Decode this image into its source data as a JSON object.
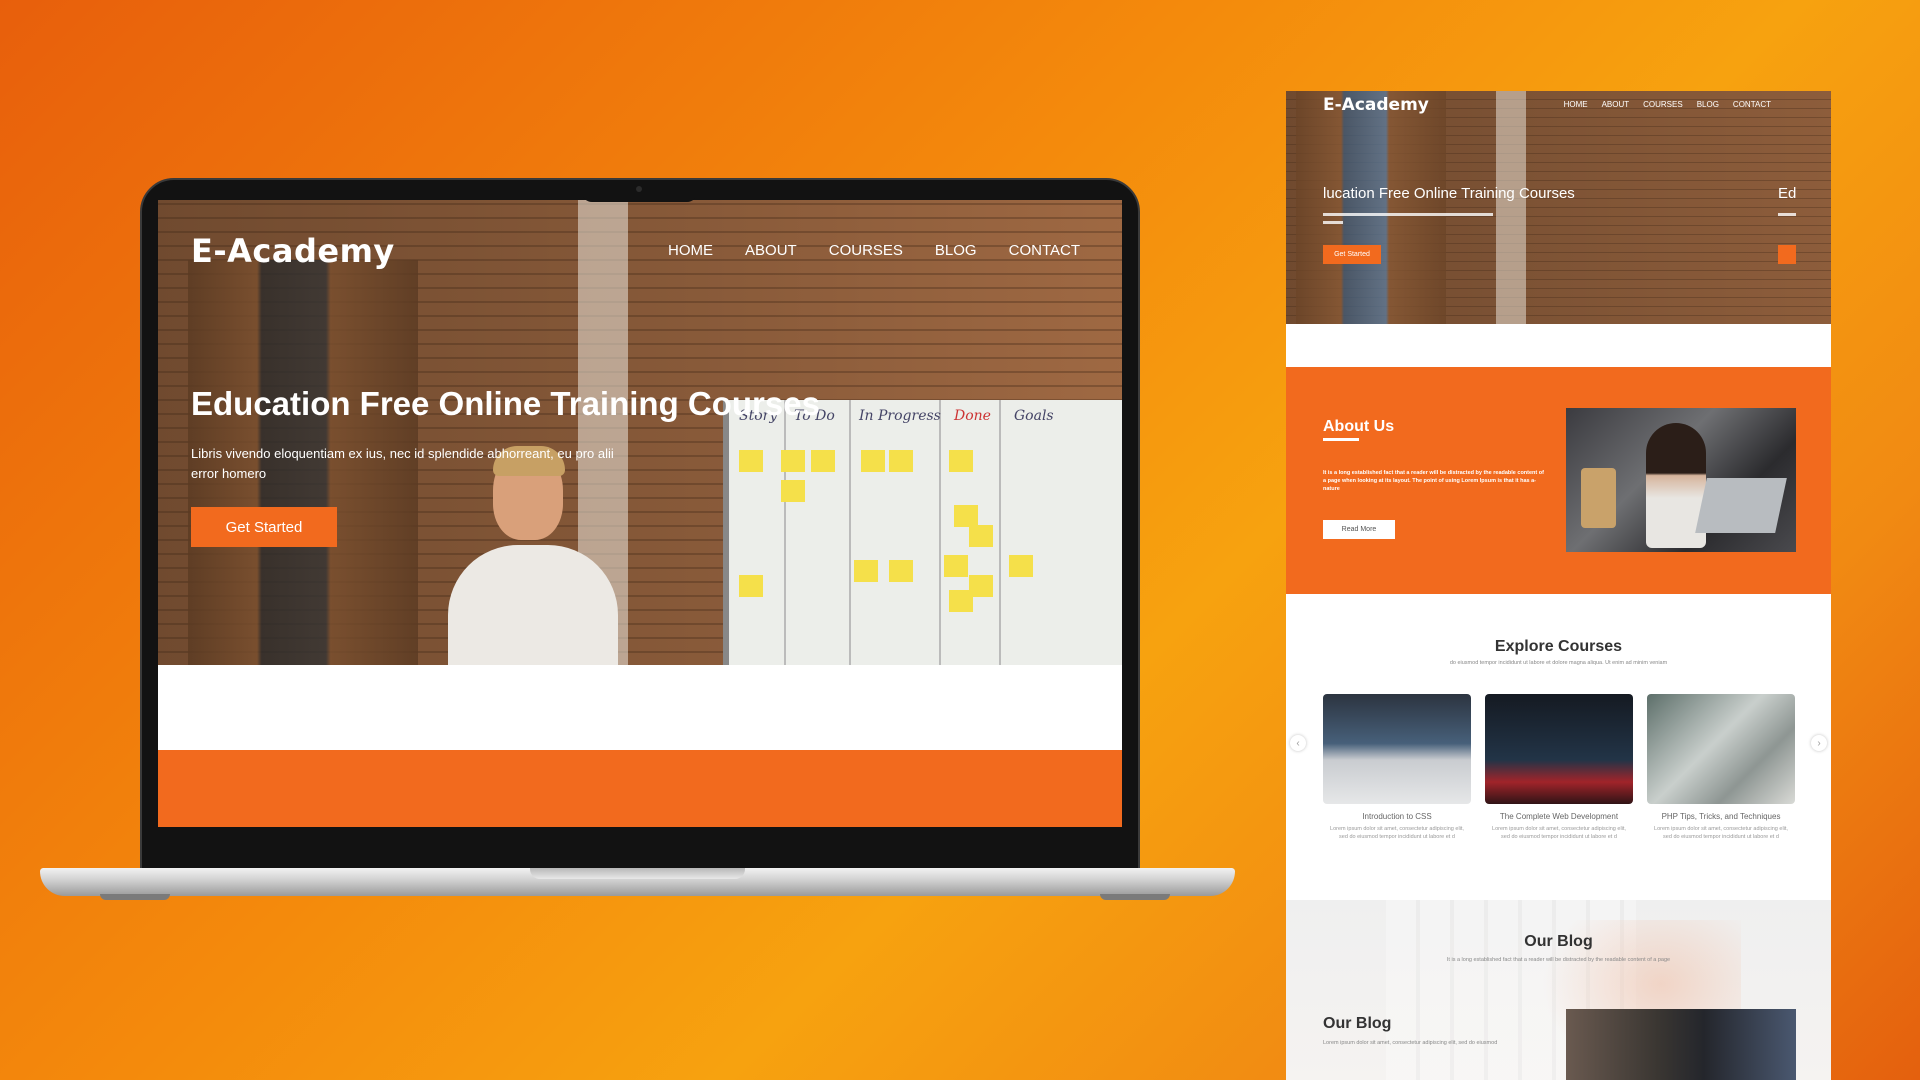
{
  "colors": {
    "accent": "#f26a1e",
    "background_gradient": [
      "#e85f0c",
      "#f7a20f"
    ]
  },
  "laptop": {
    "logo": "E-Academy",
    "nav": [
      "HOME",
      "ABOUT",
      "COURSES",
      "BLOG",
      "CONTACT"
    ],
    "hero_title": "Education Free Online Training Courses",
    "hero_subtitle": "Libris vivendo eloquentiam ex ius, nec id splendide abhorreant, eu pro alii error homero",
    "cta": "Get Started",
    "board_headings": [
      "Story",
      "To Do",
      "In Progress",
      "Done",
      "Goals"
    ]
  },
  "page": {
    "logo": "E-Academy",
    "nav": [
      "HOME",
      "ABOUT",
      "COURSES",
      "BLOG",
      "CONTACT"
    ],
    "hero_title": "lucation Free Online Training Courses",
    "hero_title_next": "Ed",
    "hero_cta": "Get Started",
    "about": {
      "title": "About Us",
      "text": "It is a long established fact that a reader will be distracted by the readable content of a page when looking at its layout. The point of using Lorem Ipsum is that it has a-nature",
      "button": "Read More"
    },
    "explore": {
      "title": "Explore Courses",
      "subtitle": "do eiusmod tempor incididunt ut labore et dolore magna aliqua. Ut enim ad minim veniam",
      "prev": "‹",
      "next": "›",
      "courses": [
        {
          "title": "Introduction to CSS",
          "desc": "Lorem ipsum dolor sit amet, consectetur adipiscing elit, sed do eiusmod tempor incididunt ut labore et d"
        },
        {
          "title": "The Complete Web Development",
          "desc": "Lorem ipsum dolor sit amet, consectetur adipiscing elit, sed do eiusmod tempor incididunt ut labore et d"
        },
        {
          "title": "PHP Tips, Tricks, and Techniques",
          "desc": "Lorem ipsum dolor sit amet, consectetur adipiscing elit, sed do eiusmod tempor incididunt ut labore et d"
        }
      ]
    },
    "blog": {
      "title": "Our Blog",
      "subtitle": "It is a long established fact that a reader will be distracted by the readable content of a page",
      "post_title": "Our Blog",
      "post_text": "Lorem ipsum dolor sit amet, consectetur adipiscing elit, sed do eiusmod"
    }
  }
}
